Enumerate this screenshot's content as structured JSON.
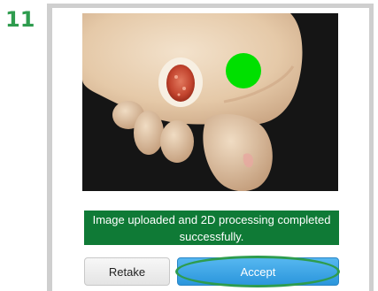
{
  "step": {
    "number": "11"
  },
  "photo": {
    "marker_color": "#00e000"
  },
  "status": {
    "message": "Image uploaded and 2D processing completed successfully.",
    "color": "#0f7a36"
  },
  "actions": {
    "retake_label": "Retake",
    "accept_label": "Accept"
  },
  "colors": {
    "step_number": "#2e9c4e",
    "accept_button": "#2b96dc",
    "highlight_ring": "#2e9c4e"
  }
}
